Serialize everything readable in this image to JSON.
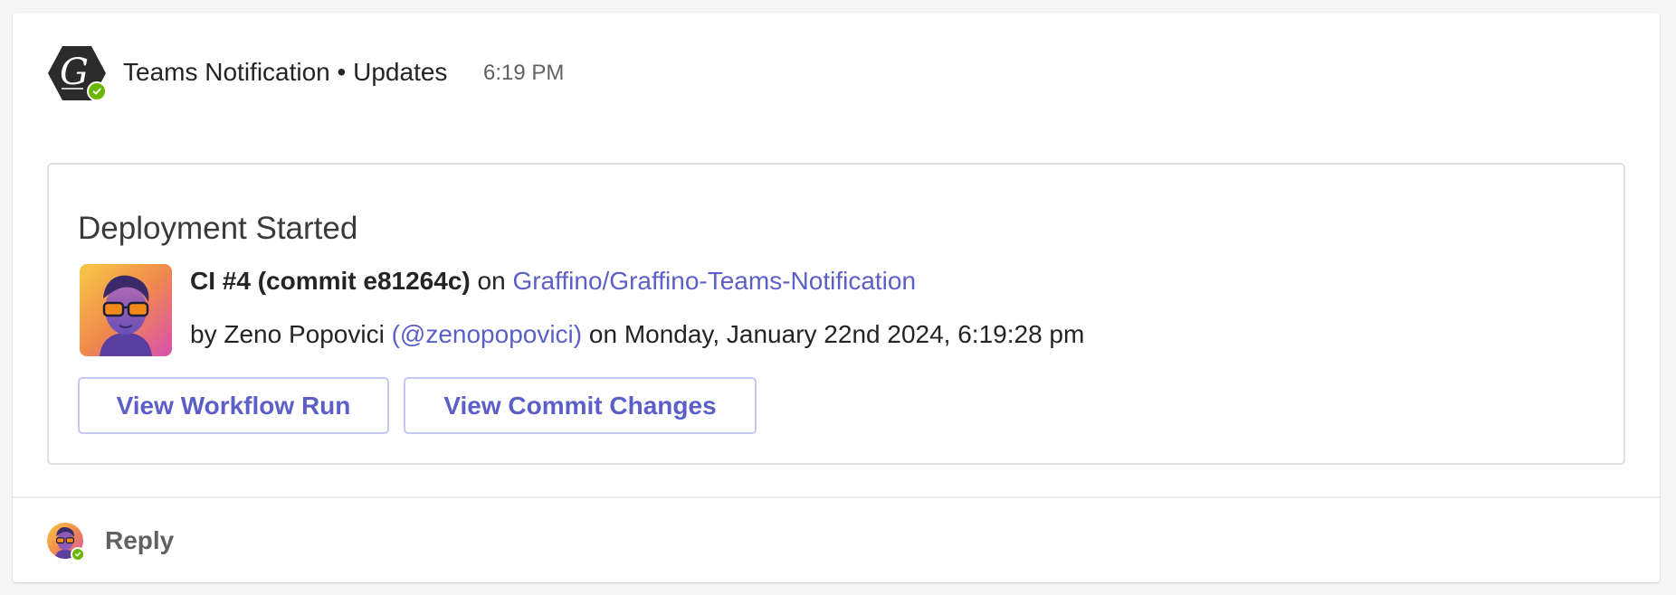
{
  "header": {
    "sender": "Teams Notification",
    "separator": "•",
    "channel": "Updates",
    "time": "6:19 PM"
  },
  "card": {
    "title": "Deployment Started",
    "run_label": "CI #4 (commit e81264c)",
    "on_text": "on",
    "repo_link": "Graffino/Graffino-Teams-Notification",
    "by_text": "by Zeno Popovici",
    "username_link": "(@zenopopovici)",
    "date_text": "on Monday, January 22nd 2024, 6:19:28 pm",
    "buttons": {
      "workflow_run": "View Workflow Run",
      "commit_changes": "View Commit Changes"
    }
  },
  "reply": {
    "label": "Reply"
  },
  "icons": {
    "app_avatar": "graffino-hexagon-logo-icon",
    "presence": "available-check-icon",
    "commit_avatar": "user-avatar-sunglasses",
    "reply_avatar": "user-avatar-sunglasses"
  },
  "colors": {
    "accent": "#5b5fc7",
    "presence": "#6bb700",
    "text": "#242424",
    "muted": "#616161",
    "card_border": "#e0e0e0",
    "button_border": "#c5c7f0"
  }
}
